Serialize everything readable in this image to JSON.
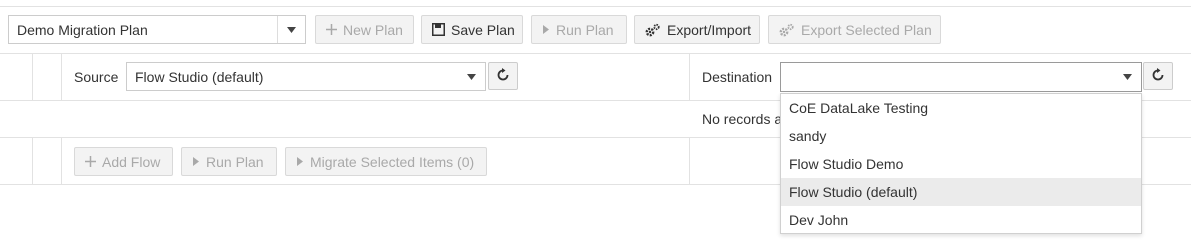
{
  "toolbar": {
    "plan_select_value": "Demo Migration Plan",
    "new_plan_label": "New Plan",
    "save_plan_label": "Save Plan",
    "run_plan_label": "Run Plan",
    "export_import_label": "Export/Import",
    "export_selected_label": "Export Selected Plan"
  },
  "source": {
    "label": "Source",
    "value": "Flow Studio (default)"
  },
  "destination": {
    "label": "Destination",
    "value": ""
  },
  "grid": {
    "empty_message": "No records a"
  },
  "footer": {
    "add_flow_label": "Add Flow",
    "run_plan_label": "Run Plan",
    "migrate_label": "Migrate Selected Items (0)"
  },
  "destination_options": [
    "CoE DataLake Testing",
    "sandy",
    "Flow Studio Demo",
    "Flow Studio (default)",
    "Dev John"
  ],
  "destination_highlighted": "Flow Studio (default)",
  "colors": {
    "border": "#e2e2e2",
    "button_bg": "#f3f3f3",
    "disabled_text": "#a9a9a9",
    "highlight": "#ebebeb"
  }
}
